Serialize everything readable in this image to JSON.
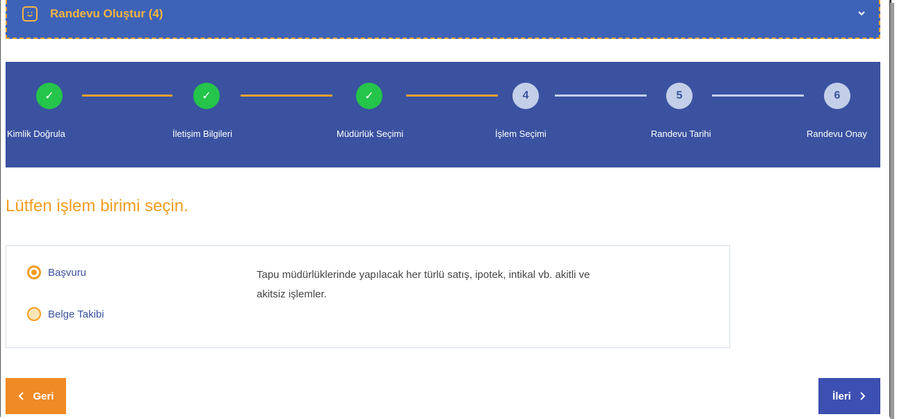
{
  "header": {
    "title": "Randevu Oluştur (4)",
    "icon": "smile-icon",
    "toggle_icon": "chevron-down-icon"
  },
  "colors": {
    "header_bg": "#3d63b8",
    "accent": "#f39c21",
    "stepper_bg": "#3a52a0",
    "done": "#24c54a"
  },
  "steps": [
    {
      "label": "Kimlik Doğrula",
      "mark": "✓",
      "status": "done"
    },
    {
      "label": "İletişim Bilgileri",
      "mark": "✓",
      "status": "done"
    },
    {
      "label": "Müdürlük Seçimi",
      "mark": "✓",
      "status": "done"
    },
    {
      "label": "İşlem Seçimi",
      "mark": "4",
      "status": "current"
    },
    {
      "label": "Randevu Tarihi",
      "mark": "5",
      "status": "todo"
    },
    {
      "label": "Randevu Onay",
      "mark": "6",
      "status": "todo"
    }
  ],
  "main": {
    "heading": "Lütfen işlem birimi seçin.",
    "options": [
      {
        "label": "Başvuru",
        "selected": true
      },
      {
        "label": "Belge Takibi",
        "selected": false
      }
    ],
    "description": "Tapu müdürlüklerinde yapılacak her türlü satış, ipotek, intikal vb. akitli ve akitsiz işlemler."
  },
  "nav": {
    "back_label": "Geri",
    "next_label": "İleri"
  }
}
